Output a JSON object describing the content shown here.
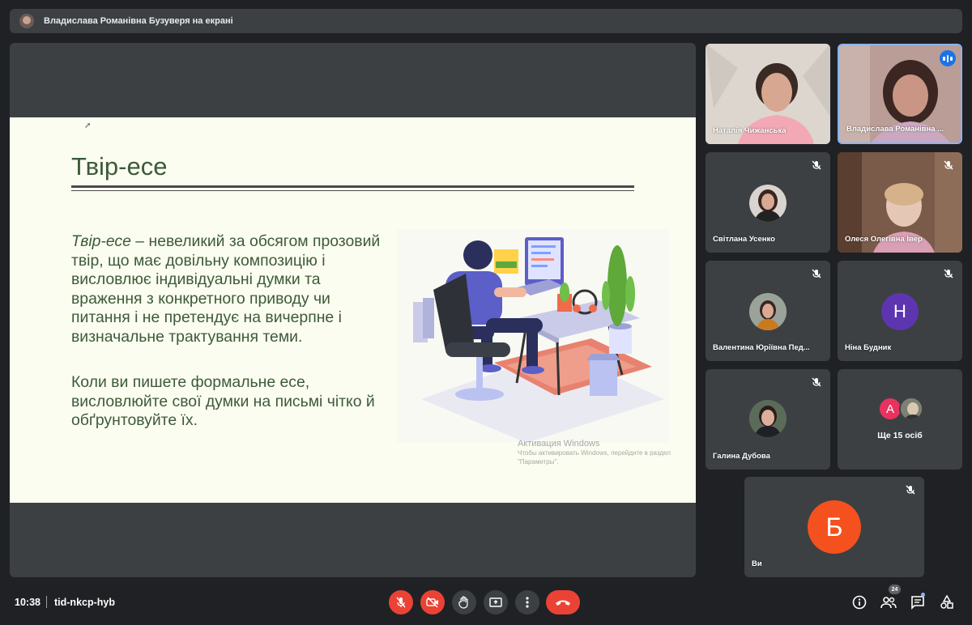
{
  "presentation_banner": "Владислава Романівна Бузуверя на екрані",
  "slide": {
    "title": "Твір-есе",
    "term": "Твір-есе",
    "definition": " – невеликий за обсягом прозовий твір, що має довільну композицію і висловлює індивідуальні думки та враження з конкретного приводу чи питання і не претендує на вичерпне і визначальне трактування теми.",
    "paragraph2": "Коли ви пишете формальне есе, висловлюйте свої думки на письмі чітко й обґрунтовуйте їх.",
    "watermark_title": "Активация Windows",
    "watermark_text": "Чтобы активировать Windows, перейдите в раздел \"Параметры\"."
  },
  "participants": [
    {
      "name": "Наталія Чижанська"
    },
    {
      "name": "Владислава Романівна ..."
    },
    {
      "name": "Світлана Усенко"
    },
    {
      "name": "Олеся Олегівна Івер"
    },
    {
      "name": "Валентина Юріївна Пед..."
    },
    {
      "name": "Ніна Будник",
      "initial": "Н"
    },
    {
      "name": "Галина Дубова"
    },
    {
      "more_initial": "А",
      "more_label": "Ще 15 осіб"
    },
    {
      "name": "Ви",
      "initial": "Б"
    }
  ],
  "bottom": {
    "time": "10:38",
    "meeting_code": "tid-nkcp-hyb",
    "people_count": "24"
  },
  "colors": {
    "end_call": "#ea4335",
    "nina_avatar": "#5e35b1",
    "you_avatar": "#f4511e",
    "more_avatar": "#e8335e"
  }
}
